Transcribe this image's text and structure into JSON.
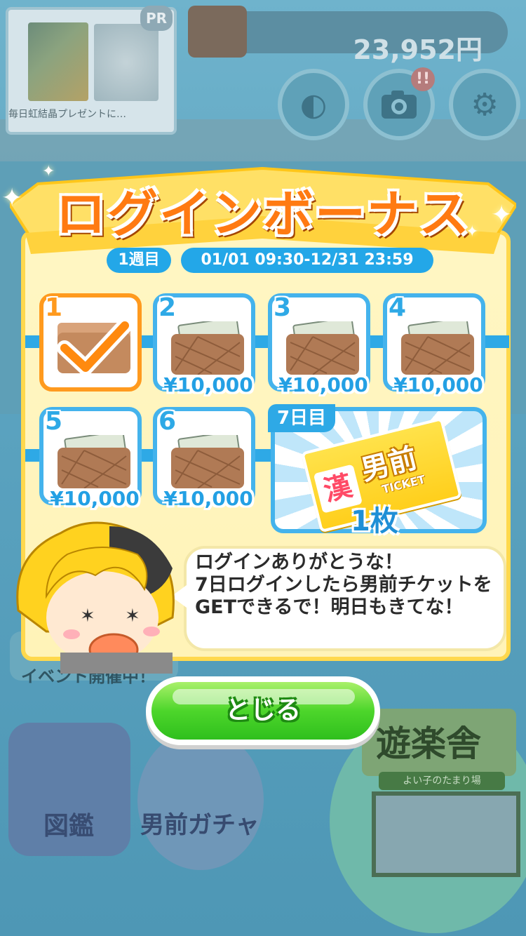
{
  "background": {
    "pr_badge": "PR",
    "pr_caption": "毎日虹結晶プレゼントに…",
    "money": "23,952円",
    "alert_badge": "!!",
    "event_label": "イベント開催中！",
    "zukan_label": "図鑑",
    "gacha_label": "男前ガチャ",
    "shop_label": "遊楽舎",
    "shop_sub": "よい子のたまり場"
  },
  "dialog": {
    "title": "ログインボーナス",
    "week": "1週目",
    "period": "01/01 09:30-12/31 23:59",
    "days": [
      {
        "num": "1",
        "status": "claimed"
      },
      {
        "num": "2",
        "amount": "¥10,000"
      },
      {
        "num": "3",
        "amount": "¥10,000"
      },
      {
        "num": "4",
        "amount": "¥10,000"
      },
      {
        "num": "5",
        "amount": "¥10,000"
      },
      {
        "num": "6",
        "amount": "¥10,000"
      }
    ],
    "day7": {
      "label": "7日目",
      "ticket_kanji": "漢",
      "ticket_name": "男前",
      "ticket_sub": "TICKET",
      "count": "1枚"
    },
    "message": "ログインありがとうな！\n7日ログインしたら男前チケットをGETできるで！明日もきてな！",
    "close_label": "とじる"
  },
  "colors": {
    "accent_blue": "#2ea9e6",
    "title_orange": "#ff7a12",
    "button_green": "#4dd62b",
    "claimed_orange": "#ff9a1e"
  }
}
